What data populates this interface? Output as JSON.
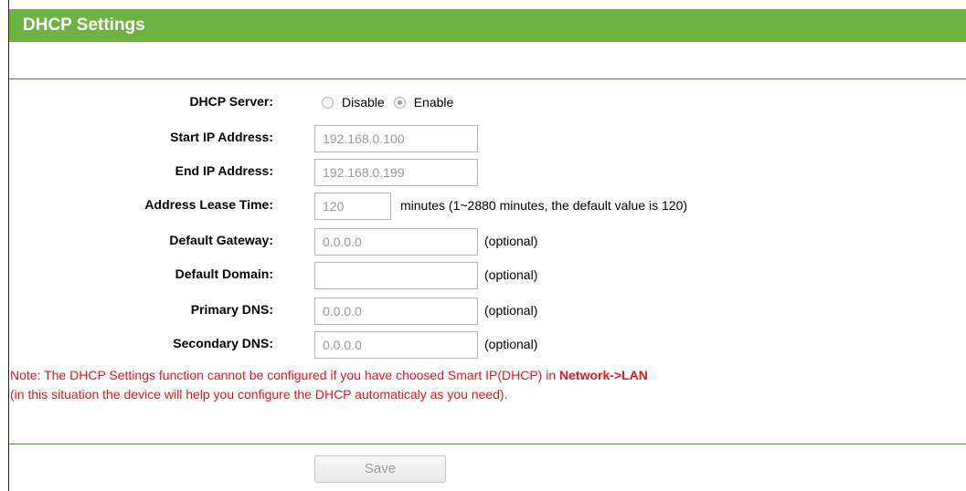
{
  "title": "DHCP Settings",
  "dhcp_server": {
    "label": "DHCP Server:",
    "options": [
      {
        "label": "Disable",
        "checked": false
      },
      {
        "label": "Enable",
        "checked": true
      }
    ]
  },
  "start_ip": {
    "label": "Start IP Address:",
    "value": "192.168.0.100"
  },
  "end_ip": {
    "label": "End IP Address:",
    "value": "192.168.0.199"
  },
  "lease_time": {
    "label": "Address Lease Time:",
    "value": "120",
    "hint": "minutes (1~2880 minutes, the default value is 120)"
  },
  "gateway": {
    "label": "Default Gateway:",
    "value": "0.0.0.0",
    "hint": "(optional)"
  },
  "domain": {
    "label": "Default Domain:",
    "value": "",
    "hint": "(optional)"
  },
  "primary_dns": {
    "label": "Primary DNS:",
    "value": "0.0.0.0",
    "hint": "(optional)"
  },
  "secondary_dns": {
    "label": "Secondary DNS:",
    "value": "0.0.0.0",
    "hint": "(optional)"
  },
  "note": {
    "line1_prefix": "Note: The DHCP Settings function cannot be configured if you have choosed Smart IP(DHCP) in ",
    "line1_link": "Network->LAN",
    "line2": "(in this situation the device will help you configure the DHCP automaticaly as you need)."
  },
  "save_label": "Save",
  "colors": {
    "title_bar": "#6db33f",
    "divider": "#3e8f2b",
    "note_text": "#e8141b"
  }
}
